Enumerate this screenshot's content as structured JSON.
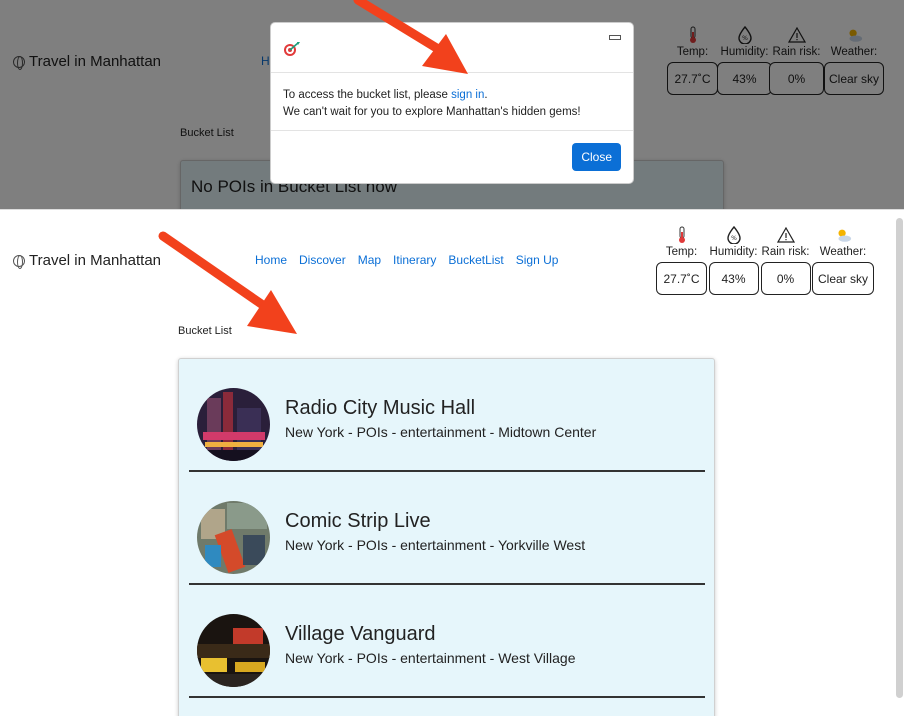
{
  "brand": "Travel in Manhattan",
  "nav": [
    "Home",
    "Discover",
    "Map",
    "Itinerary",
    "BucketList",
    "Sign Up"
  ],
  "nav_top_partial": "H",
  "weather": {
    "labels": [
      "Temp:",
      "Humidity:",
      "Rain risk:",
      "Weather:"
    ],
    "values": [
      "27.7˚C",
      "43%",
      "0%",
      "Clear sky"
    ],
    "icons": [
      "thermometer-icon",
      "humidity-drop-icon",
      "warning-triangle-icon",
      "partly-sunny-icon"
    ]
  },
  "bucket_label": "Bucket List",
  "empty_text": "No POIs in Bucket List now",
  "modal": {
    "line1_prefix": "To access the bucket list, please ",
    "link": "sign in",
    "line1_suffix": ".",
    "line2": "We can't wait for you to explore Manhattan's hidden gems!",
    "close": "Close"
  },
  "pois": [
    {
      "name": "Radio City Music Hall",
      "sub": "New York - POIs - entertainment - Midtown Center"
    },
    {
      "name": "Comic Strip Live",
      "sub": "New York - POIs - entertainment - Yorkville West"
    },
    {
      "name": "Village Vanguard",
      "sub": "New York - POIs - entertainment - West Village"
    }
  ],
  "colors": {
    "link": "#0b6fd6",
    "card_bg": "#e6f6fb",
    "arrow": "#f2411c"
  }
}
